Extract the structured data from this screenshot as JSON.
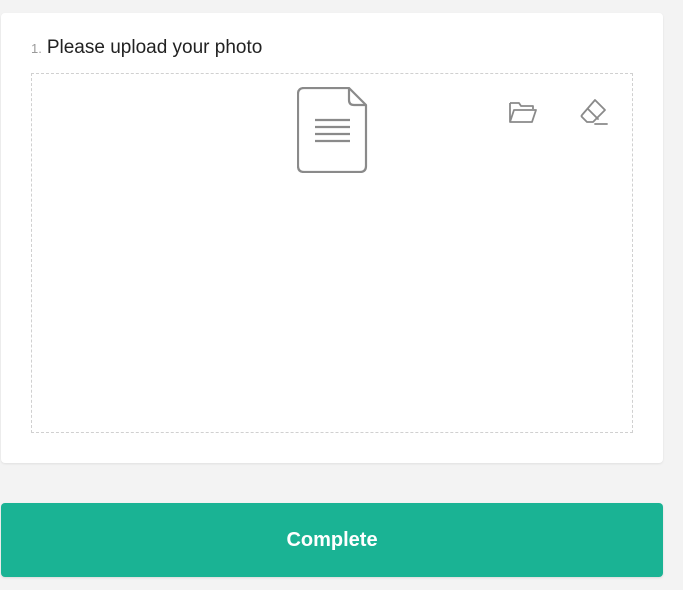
{
  "question": {
    "number": "1.",
    "text": "Please upload your photo"
  },
  "dropzone": {
    "file_icon": "document-icon",
    "tools": [
      {
        "icon": "folder-open-icon"
      },
      {
        "icon": "eraser-icon"
      }
    ]
  },
  "complete_button": {
    "label": "Complete"
  },
  "colors": {
    "accent": "#1ab394",
    "background": "#f3f3f3",
    "card": "#ffffff",
    "icon": "#8a8a8a"
  }
}
